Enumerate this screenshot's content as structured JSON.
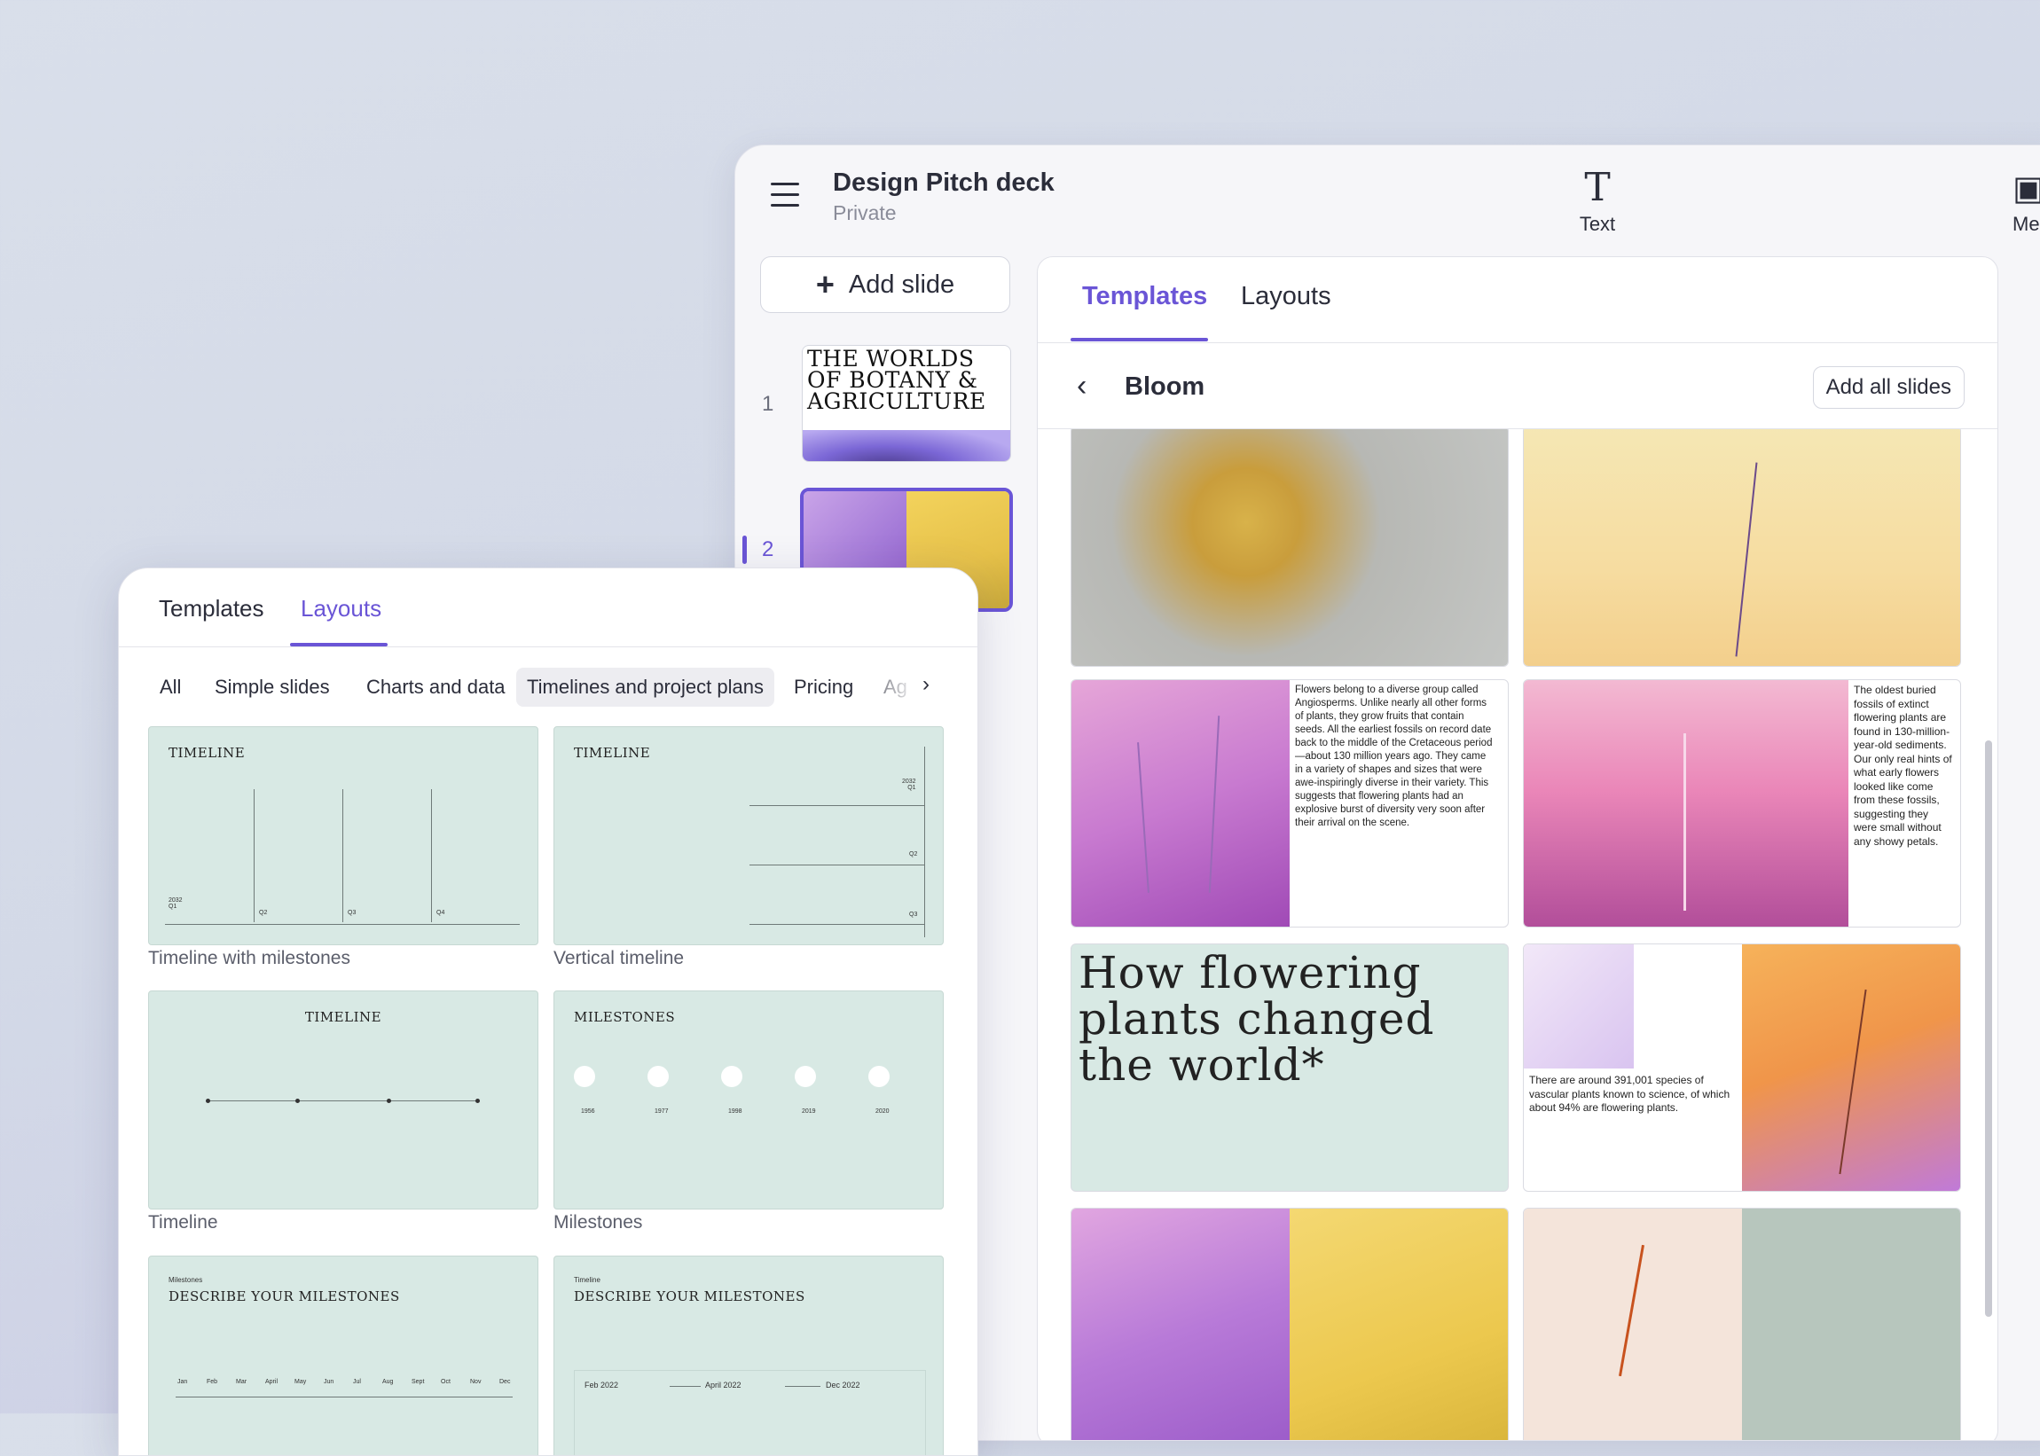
{
  "doc": {
    "title": "Design Pitch deck",
    "visibility": "Private"
  },
  "toolbar": {
    "text_label": "Text",
    "media_label": "Me"
  },
  "slides_panel": {
    "add_slide_label": "Add slide",
    "slides": [
      {
        "number": "1",
        "title": "THE WORLDS OF BOTANY & AGRICULTURE"
      },
      {
        "number": "2"
      }
    ]
  },
  "templates_panel": {
    "tabs": [
      {
        "label": "Templates"
      },
      {
        "label": "Layouts"
      }
    ],
    "collection_title": "Bloom",
    "add_all_label": "Add all slides",
    "cards": [
      {
        "text": "Flowers belong to a diverse group called Angiosperms. Unlike nearly all other forms of plants, they grow fruits that contain seeds. All the earliest fossils on record date back to the middle of the Cretaceous period —about 130 million years ago. They came in a variety of shapes and sizes that were awe-inspiringly diverse in their variety. This suggests that flowering plants had an explosive burst of diversity very soon after their arrival on the scene."
      },
      {
        "text": "The oldest buried fossils of extinct flowering plants are found in 130-million-year-old sediments. Our only real hints of what early flowers looked like come from these fossils, suggesting they were small without any showy petals."
      },
      {
        "headline": "How flowering plants changed the world*"
      },
      {
        "text": "There are around 391,001 species of vascular plants known to science, of which about 94% are flowering plants."
      }
    ]
  },
  "layouts_panel": {
    "tabs": [
      {
        "label": "Templates"
      },
      {
        "label": "Layouts"
      }
    ],
    "filters": [
      {
        "label": "All"
      },
      {
        "label": "Simple slides"
      },
      {
        "label": "Charts and data"
      },
      {
        "label": "Timelines and project plans"
      },
      {
        "label": "Pricing"
      },
      {
        "label": "Ag"
      }
    ],
    "layouts": [
      {
        "heading": "TIMELINE",
        "caption": "Timeline with milestones",
        "ticks": [
          "2032\nQ1",
          "Q2",
          "Q3",
          "Q4"
        ]
      },
      {
        "heading": "TIMELINE",
        "caption": "Vertical timeline",
        "ticks": [
          "2032\nQ1",
          "Q2",
          "Q3"
        ]
      },
      {
        "heading": "TIMELINE",
        "caption": "Timeline"
      },
      {
        "heading": "MILESTONES",
        "caption": "Milestones",
        "years": [
          "1956",
          "1977",
          "1998",
          "2019",
          "2020"
        ]
      },
      {
        "kicker": "Milestones",
        "heading": "DESCRIBE YOUR MILESTONES",
        "months": [
          "Jan",
          "Feb",
          "Mar",
          "April",
          "May",
          "Jun",
          "Jul",
          "Aug",
          "Sept",
          "Oct",
          "Nov",
          "Dec"
        ]
      },
      {
        "kicker": "Timeline",
        "heading": "DESCRIBE YOUR MILESTONES",
        "dates": [
          "Feb 2022",
          "April 2022",
          "Dec 2022"
        ]
      }
    ]
  },
  "colors": {
    "accent": "#6a55d6",
    "layout_bg": "#d8e9e4"
  }
}
